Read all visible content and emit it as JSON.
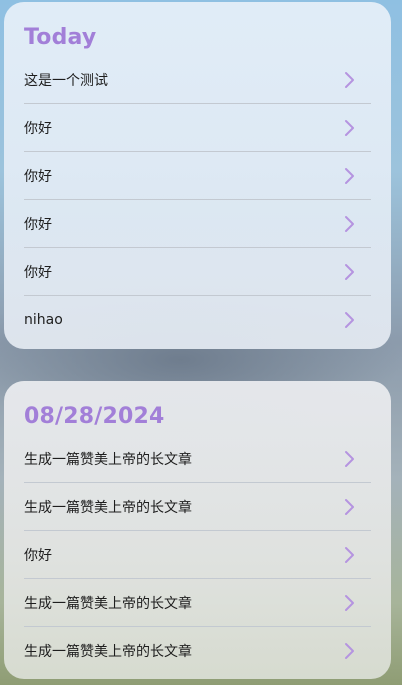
{
  "sections": [
    {
      "title": "Today",
      "items": [
        {
          "label": "这是一个测试",
          "icon": "chevron-right-icon"
        },
        {
          "label": "你好",
          "icon": "chevron-right-icon"
        },
        {
          "label": "你好",
          "icon": "chevron-right-icon"
        },
        {
          "label": "你好",
          "icon": "chevron-right-icon"
        },
        {
          "label": "你好",
          "icon": "chevron-right-icon"
        },
        {
          "label": "nihao",
          "icon": "chevron-right-icon"
        }
      ]
    },
    {
      "title": "08/28/2024",
      "items": [
        {
          "label": "生成一篇赞美上帝的长文章",
          "icon": "chevron-right-icon"
        },
        {
          "label": "生成一篇赞美上帝的长文章",
          "icon": "chevron-right-icon"
        },
        {
          "label": "你好",
          "icon": "chevron-right-icon"
        },
        {
          "label": "生成一篇赞美上帝的长文章",
          "icon": "chevron-right-icon"
        },
        {
          "label": "生成一篇赞美上帝的长文章",
          "icon": "chevron-right-icon"
        }
      ]
    }
  ],
  "colors": {
    "accent": "#a27fd8",
    "chevron": "#b594e0",
    "divider": "#c3c9d1",
    "text": "#1e1e1e"
  }
}
